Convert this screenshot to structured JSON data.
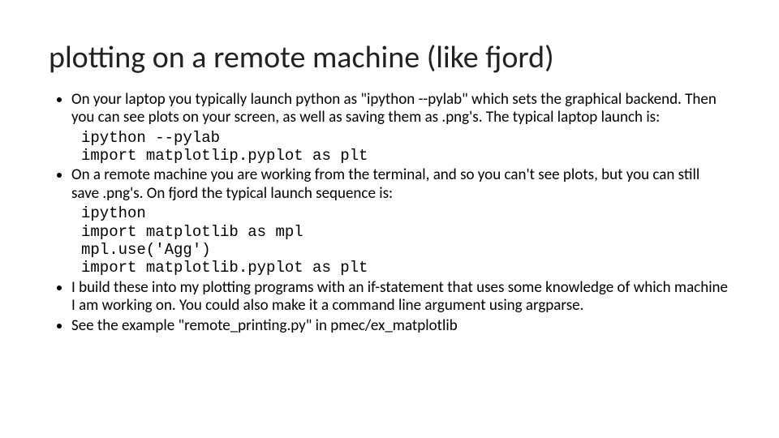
{
  "title": "plotting on a remote machine (like fjord)",
  "bullets": {
    "b1": "On your laptop you typically launch python as \"ipython --pylab\" which sets the graphical backend.  Then you can see plots on your screen, as well as saving them as .png's.  The typical laptop launch is:",
    "code1": "ipython --pylab\nimport matplotlip.pyplot as plt",
    "b2": "On a remote machine you are working from the terminal, and so you can't see plots, but you can still save .png's.  On fjord the typical launch sequence is:",
    "code2": "ipython\nimport matplotlib as mpl\nmpl.use('Agg')\nimport matplotlib.pyplot as plt",
    "b3": "I build these into my plotting programs with an if-statement that uses some knowledge of which machine I am working on.  You could also make it a command line argument using argparse.",
    "b4": "See the example \"remote_printing.py\" in pmec/ex_matplotlib"
  }
}
